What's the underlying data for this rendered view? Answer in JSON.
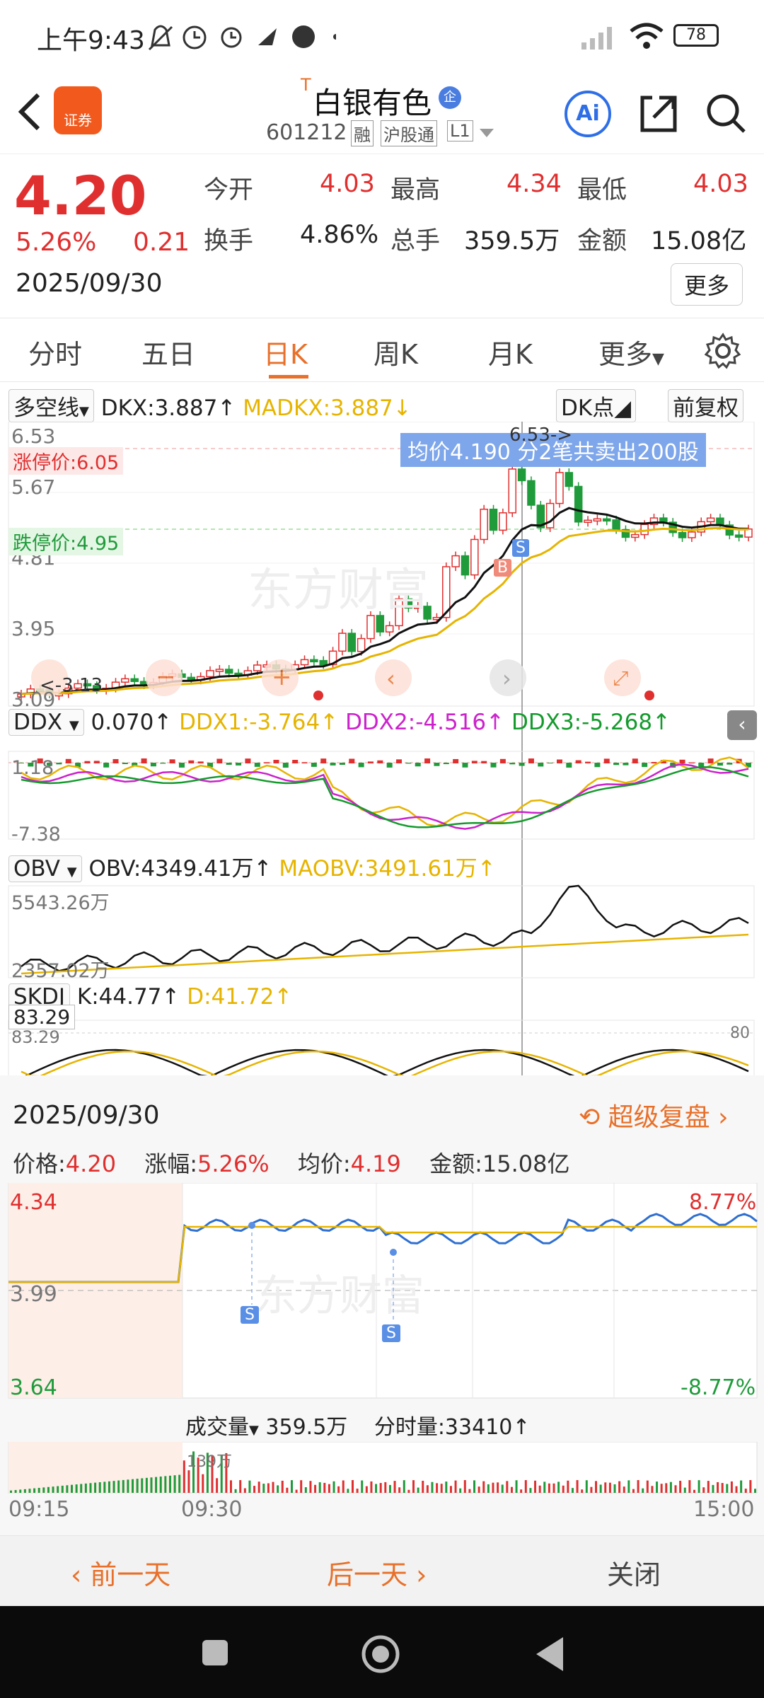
{
  "status_bar": {
    "time": "上午9:43",
    "battery": "78"
  },
  "header": {
    "broker_badge": "证券",
    "stock_name": "白银有色",
    "stock_prefix": "T",
    "name_badge": "企",
    "code": "601212",
    "tags": [
      "融",
      "沪股通",
      "L1"
    ],
    "ai_label": "Ai"
  },
  "quote": {
    "price": "4.20",
    "change_pct": "5.26%",
    "change": "0.21",
    "date": "2025/09/30",
    "more_label": "更多",
    "stats": [
      {
        "label": "今开",
        "value": "4.03",
        "color": "red"
      },
      {
        "label": "最高",
        "value": "4.34",
        "color": "red"
      },
      {
        "label": "最低",
        "value": "4.03",
        "color": "red"
      },
      {
        "label": "换手",
        "value": "4.86%",
        "color": "dark"
      },
      {
        "label": "总手",
        "value": "359.5万",
        "color": "dark"
      },
      {
        "label": "金额",
        "value": "15.08亿",
        "color": "dark"
      }
    ]
  },
  "tabs": [
    "分时",
    "五日",
    "日K",
    "周K",
    "月K",
    "更多"
  ],
  "active_tab": "日K",
  "kchart": {
    "indicator_select": "多空线",
    "dkx": "DKX:3.887",
    "madkx": "MADKX:3.887",
    "dk_points_label": "DK点",
    "fq_label": "前复权",
    "price_axis": [
      "6.53",
      "5.67",
      "4.81",
      "3.95",
      "3.09"
    ],
    "limit_up": "涨停价:6.05",
    "limit_down": "跌停价:4.95",
    "avg_banner": "均价4.190  分2笔共卖出200股",
    "high_mark": "6.53->",
    "low_mark": "<-3.13",
    "marker_b": "B",
    "marker_s": "S",
    "ddx": {
      "select": "DDX",
      "ddx": "0.070",
      "ddx1": "DDX1:-3.764",
      "ddx2": "DDX2:-4.516",
      "ddx3": "DDX3:-5.268",
      "axis_top": "1.18",
      "axis_bottom": "-7.38"
    },
    "obv": {
      "select": "OBV",
      "obv": "OBV:4349.41万",
      "maobv": "MAOBV:3491.61万",
      "axis_top": "5543.26万",
      "axis_bottom": "2357.02万"
    },
    "skdj": {
      "select": "SKDJ",
      "k": "K:44.77",
      "d": "D:41.72",
      "value_box": "83.29",
      "axis_top": "83.29",
      "level": "80"
    }
  },
  "detail": {
    "date": "2025/09/30",
    "replay_label": "超级复盘",
    "price_label": "价格:",
    "price": "4.20",
    "change_label": "涨幅:",
    "change": "5.26%",
    "avg_label": "均价:",
    "avg": "4.19",
    "amount": "金额:15.08亿",
    "axis_top": "4.34",
    "axis_mid": "3.99",
    "axis_bottom": "3.64",
    "pct_top": "8.77%",
    "pct_bottom": "-8.77%",
    "volume_select": "成交量",
    "volume_total": "359.5万",
    "minute_volume": "分时量:33410",
    "volume_axis": "139万",
    "time_start": "09:15",
    "time_mid": "09:30",
    "time_end": "15:00",
    "marker_s": "S"
  },
  "bottom_actions": {
    "prev": "前一天",
    "next": "后一天",
    "close": "关闭"
  },
  "colors": {
    "up": "#e02f2f",
    "down": "#1f9b3b",
    "accent": "#e8702a",
    "blue_banner": "#6f9fe8"
  }
}
